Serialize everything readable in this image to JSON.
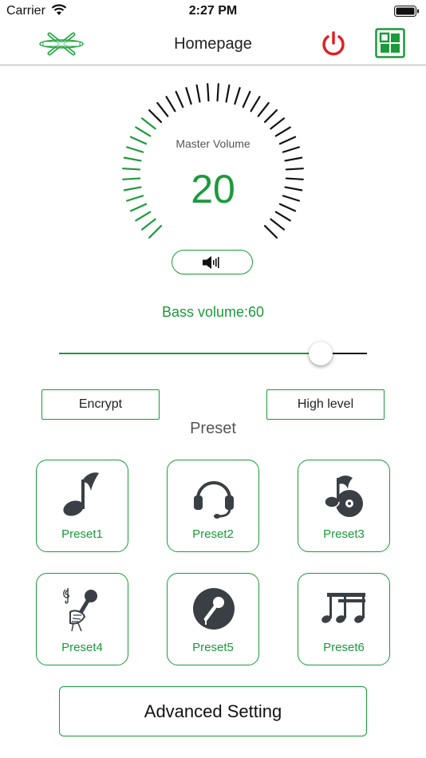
{
  "status_bar": {
    "carrier": "Carrier",
    "time": "2:27 PM"
  },
  "nav": {
    "title": "Homepage",
    "power_icon": "power-icon",
    "grid_icon": "grid-menu-icon"
  },
  "master_volume": {
    "label": "Master Volume",
    "value": "20",
    "level": 0.33,
    "mute_icon": "speaker-icon"
  },
  "bass": {
    "label": "Bass volume:60",
    "slider_fraction": 0.85
  },
  "buttons": {
    "encrypt": "Encrypt",
    "high_level": "High level"
  },
  "preset_heading": "Preset",
  "presets": [
    {
      "label": "Preset1",
      "icon": "music-note-icon"
    },
    {
      "label": "Preset2",
      "icon": "headset-icon"
    },
    {
      "label": "Preset3",
      "icon": "music-disc-icon"
    },
    {
      "label": "Preset4",
      "icon": "singer-microphone-icon"
    },
    {
      "label": "Preset5",
      "icon": "microphone-icon"
    },
    {
      "label": "Preset6",
      "icon": "music-notes-icon"
    }
  ],
  "advanced_setting": "Advanced Setting",
  "colors": {
    "accent": "#1a9a3a",
    "power": "#e02020",
    "inactive_tick": "#111111"
  }
}
